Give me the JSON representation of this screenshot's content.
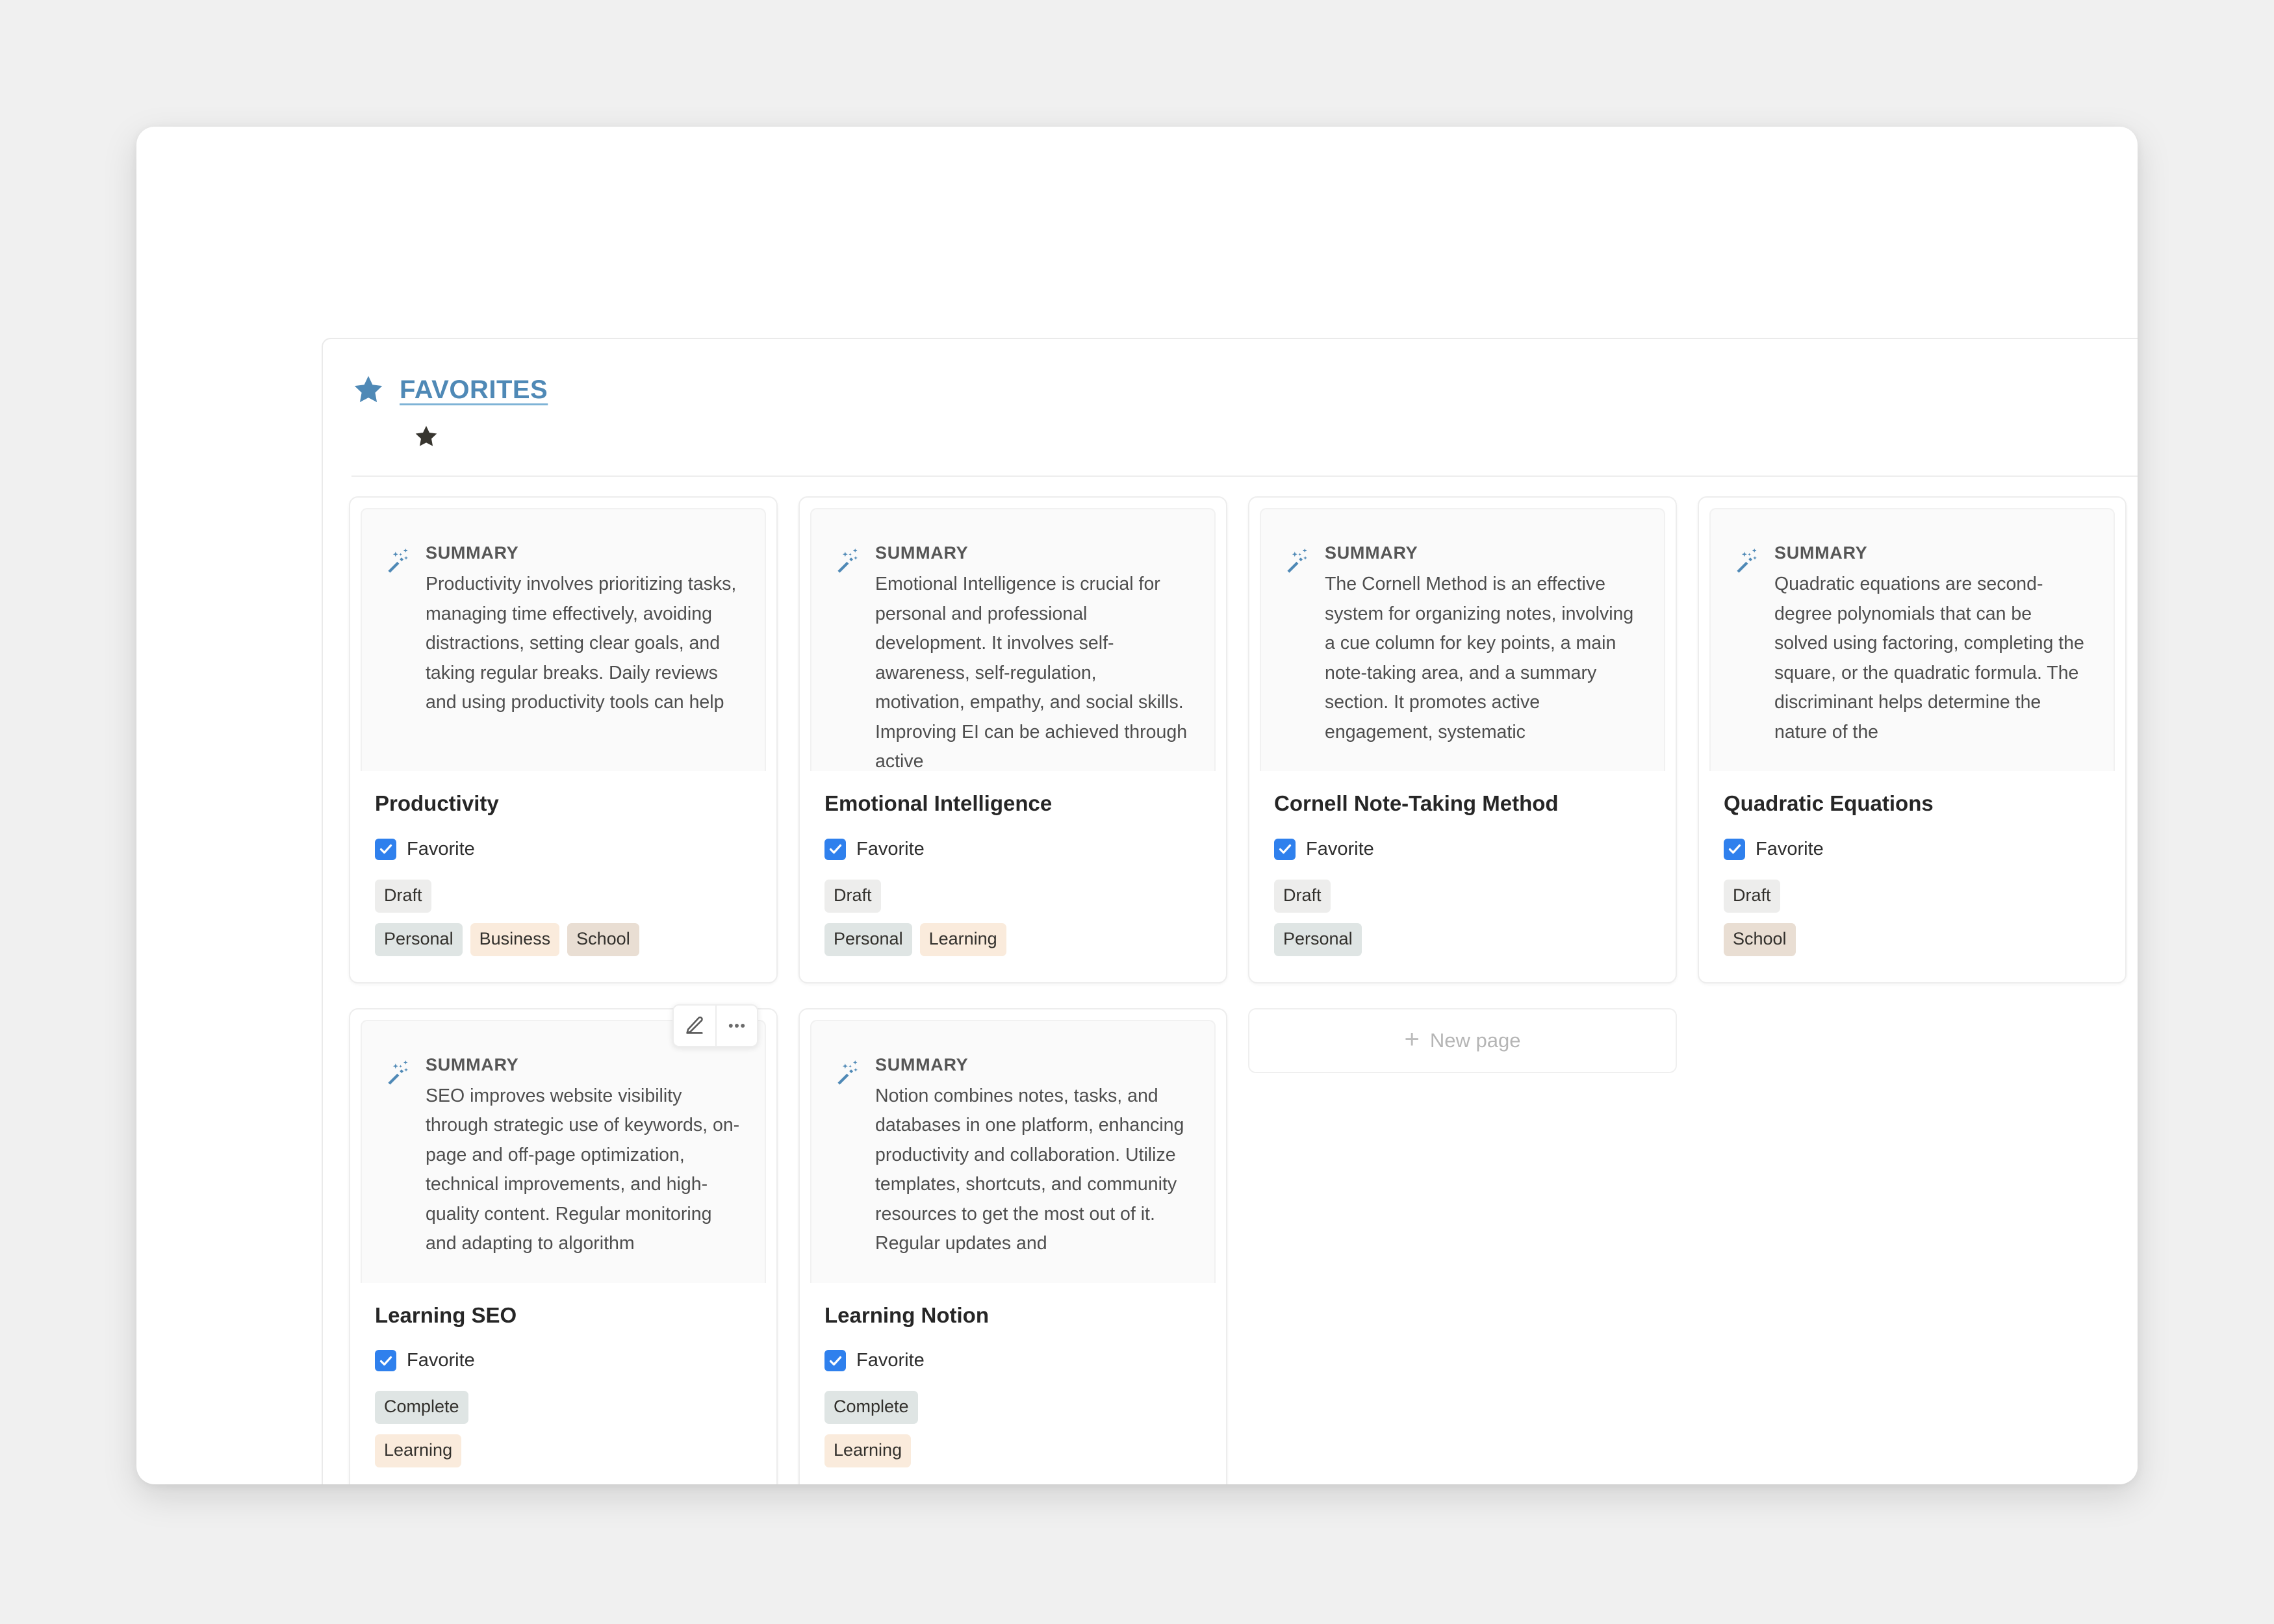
{
  "window": {
    "title": ""
  },
  "header": {
    "star_icon": "star-icon",
    "title": "FAVORITES",
    "title_color": "#4f89b6",
    "row_star_icon": "star-icon"
  },
  "labels": {
    "summary_label": "SUMMARY",
    "favorite_label": "Favorite",
    "summary_icon": "magic-wand-icon",
    "edit_icon": "pencil-icon",
    "more_icon": "more-options-icon"
  },
  "colors": {
    "accent_blue": "#4f89b6",
    "checkbox_blue": "#2f80ed",
    "tag_gray": "#ededec",
    "tag_blue": "#dfe5e4",
    "tag_orange": "#faebdc",
    "tag_beige": "#e9ded3"
  },
  "new_page": {
    "label": "New page",
    "plus": "+"
  },
  "cards": [
    {
      "summary_label": "SUMMARY",
      "summary": "Productivity involves prioritizing tasks, managing time effectively, avoiding distractions, setting clear goals, and taking regular breaks. Daily reviews and using productivity tools can help",
      "title": "Productivity",
      "favorite_label": "Favorite",
      "favorite_checked": true,
      "status": "Draft",
      "status_style": "tag-gray",
      "tags": [
        {
          "label": "Personal",
          "style": "tag-blue"
        },
        {
          "label": "Business",
          "style": "tag-orange"
        },
        {
          "label": "School",
          "style": "tag-beige"
        }
      ],
      "hover_toolbar": false
    },
    {
      "summary_label": "SUMMARY",
      "summary": "Emotional Intelligence is crucial for personal and professional development. It involves self-awareness, self-regulation, motivation, empathy, and social skills. Improving EI can be achieved through active",
      "title": "Emotional Intelligence",
      "favorite_label": "Favorite",
      "favorite_checked": true,
      "status": "Draft",
      "status_style": "tag-gray",
      "tags": [
        {
          "label": "Personal",
          "style": "tag-blue"
        },
        {
          "label": "Learning",
          "style": "tag-orange"
        }
      ],
      "hover_toolbar": false
    },
    {
      "summary_label": "SUMMARY",
      "summary": "The Cornell Method is an effective system for organizing notes, involving a cue column for key points, a main note-taking area, and a summary section. It promotes active engagement, systematic",
      "title": "Cornell Note-Taking Method",
      "favorite_label": "Favorite",
      "favorite_checked": true,
      "status": "Draft",
      "status_style": "tag-gray",
      "tags": [
        {
          "label": "Personal",
          "style": "tag-blue"
        }
      ],
      "hover_toolbar": false
    },
    {
      "summary_label": "SUMMARY",
      "summary": "Quadratic equations are second-degree polynomials that can be solved using factoring, completing the square, or the quadratic formula. The discriminant helps determine the nature of the",
      "title": "Quadratic Equations",
      "favorite_label": "Favorite",
      "favorite_checked": true,
      "status": "Draft",
      "status_style": "tag-gray",
      "tags": [
        {
          "label": "School",
          "style": "tag-beige"
        }
      ],
      "hover_toolbar": false
    },
    {
      "summary_label": "SUMMARY",
      "summary": "SEO improves website visibility through strategic use of keywords, on-page and off-page optimization, technical improvements, and high-quality content. Regular monitoring and adapting to algorithm",
      "title": "Learning SEO",
      "favorite_label": "Favorite",
      "favorite_checked": true,
      "status": "Complete",
      "status_style": "tag-blue",
      "tags": [
        {
          "label": "Learning",
          "style": "tag-orange"
        }
      ],
      "hover_toolbar": true
    },
    {
      "summary_label": "SUMMARY",
      "summary": "Notion combines notes, tasks, and databases in one platform, enhancing productivity and collaboration. Utilize templates, shortcuts, and community resources to get the most out of it. Regular updates and",
      "title": "Learning Notion",
      "favorite_label": "Favorite",
      "favorite_checked": true,
      "status": "Complete",
      "status_style": "tag-blue",
      "tags": [
        {
          "label": "Learning",
          "style": "tag-orange"
        }
      ],
      "hover_toolbar": false
    }
  ]
}
